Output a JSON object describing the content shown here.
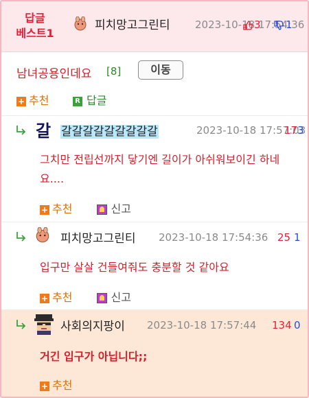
{
  "best": {
    "label_line1": "답글",
    "label_line2": "베스트1",
    "nickname": "피치망고그린티",
    "date": "2023-10-18 17:54:36",
    "up": "3",
    "down": "1"
  },
  "post": {
    "title": "남녀공용인데요",
    "reply_count": "[8]",
    "move_button": "이동",
    "recommend_label": "추천",
    "reply_label": "답글"
  },
  "comments": [
    {
      "nickname": "갈갈갈갈갈갈갈갈갈",
      "date": "2023-10-18 17:57:03",
      "up": "17",
      "down": "3",
      "text": "그치만 전립선까지 닿기엔 길이가 아쉬워보이긴 하네요....",
      "recommend_label": "추천",
      "report_label": "신고"
    },
    {
      "nickname": "피치망고그린티",
      "date": "2023-10-18 17:54:36",
      "up": "25",
      "down": "1",
      "text": "입구만 살살 건들여줘도 충분할 것 같아요",
      "recommend_label": "추천",
      "report_label": "신고"
    },
    {
      "nickname": "사회의지팡이",
      "date": "2023-10-18 17:57:44",
      "up": "134",
      "down": "0",
      "text": "거긴 입구가 아닙니다;;",
      "recommend_label": "추천"
    }
  ],
  "colors": {
    "accent_red": "#d4202c",
    "best_bg": "#fde8ec",
    "highlight_bg": "#fde8d8",
    "border_pink": "#f5b7c1"
  }
}
